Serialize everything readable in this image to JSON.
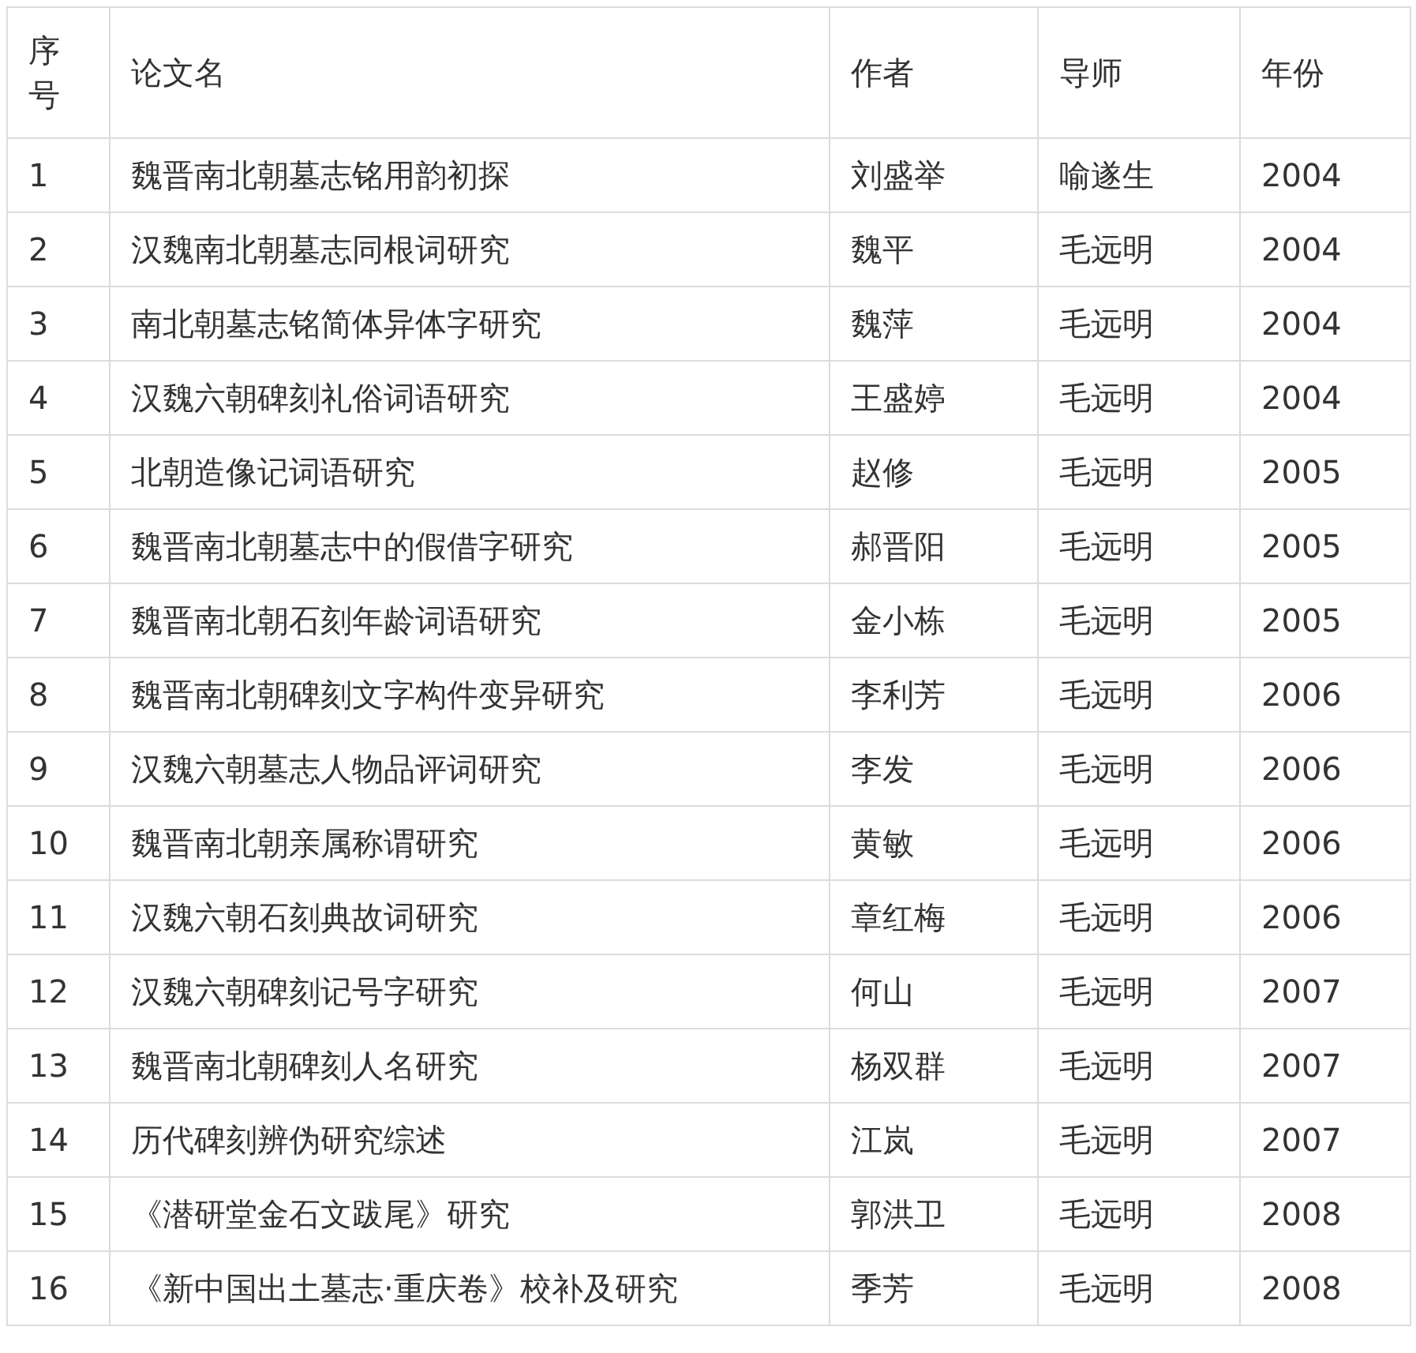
{
  "table": {
    "columns": [
      "序号",
      "论文名",
      "作者",
      "导师",
      "年份"
    ],
    "rows": [
      [
        "1",
        "魏晋南北朝墓志铭用韵初探",
        "刘盛举",
        "喻遂生",
        "2004"
      ],
      [
        "2",
        "汉魏南北朝墓志同根词研究",
        "魏平",
        "毛远明",
        "2004"
      ],
      [
        "3",
        "南北朝墓志铭简体异体字研究",
        "魏萍",
        "毛远明",
        "2004"
      ],
      [
        "4",
        "汉魏六朝碑刻礼俗词语研究",
        "王盛婷",
        "毛远明",
        "2004"
      ],
      [
        "5",
        "北朝造像记词语研究",
        "赵修",
        "毛远明",
        "2005"
      ],
      [
        "6",
        "魏晋南北朝墓志中的假借字研究",
        "郝晋阳",
        "毛远明",
        "2005"
      ],
      [
        "7",
        "魏晋南北朝石刻年龄词语研究",
        "金小栋",
        "毛远明",
        "2005"
      ],
      [
        "8",
        "魏晋南北朝碑刻文字构件变异研究",
        "李利芳",
        "毛远明",
        "2006"
      ],
      [
        "9",
        "汉魏六朝墓志人物品评词研究",
        "李发",
        "毛远明",
        "2006"
      ],
      [
        "10",
        "魏晋南北朝亲属称谓研究",
        "黄敏",
        "毛远明",
        "2006"
      ],
      [
        "11",
        "汉魏六朝石刻典故词研究",
        "章红梅",
        "毛远明",
        "2006"
      ],
      [
        "12",
        "汉魏六朝碑刻记号字研究",
        "何山",
        "毛远明",
        "2007"
      ],
      [
        "13",
        "魏晋南北朝碑刻人名研究",
        "杨双群",
        "毛远明",
        "2007"
      ],
      [
        "14",
        "历代碑刻辨伪研究综述",
        "江岚",
        "毛远明",
        "2007"
      ],
      [
        "15",
        "《潜研堂金石文跋尾》研究",
        "郭洪卫",
        "毛远明",
        "2008"
      ],
      [
        "16",
        "《新中国出土墓志·重庆卷》校补及研究",
        "季芳",
        "毛远明",
        "2008"
      ]
    ]
  }
}
